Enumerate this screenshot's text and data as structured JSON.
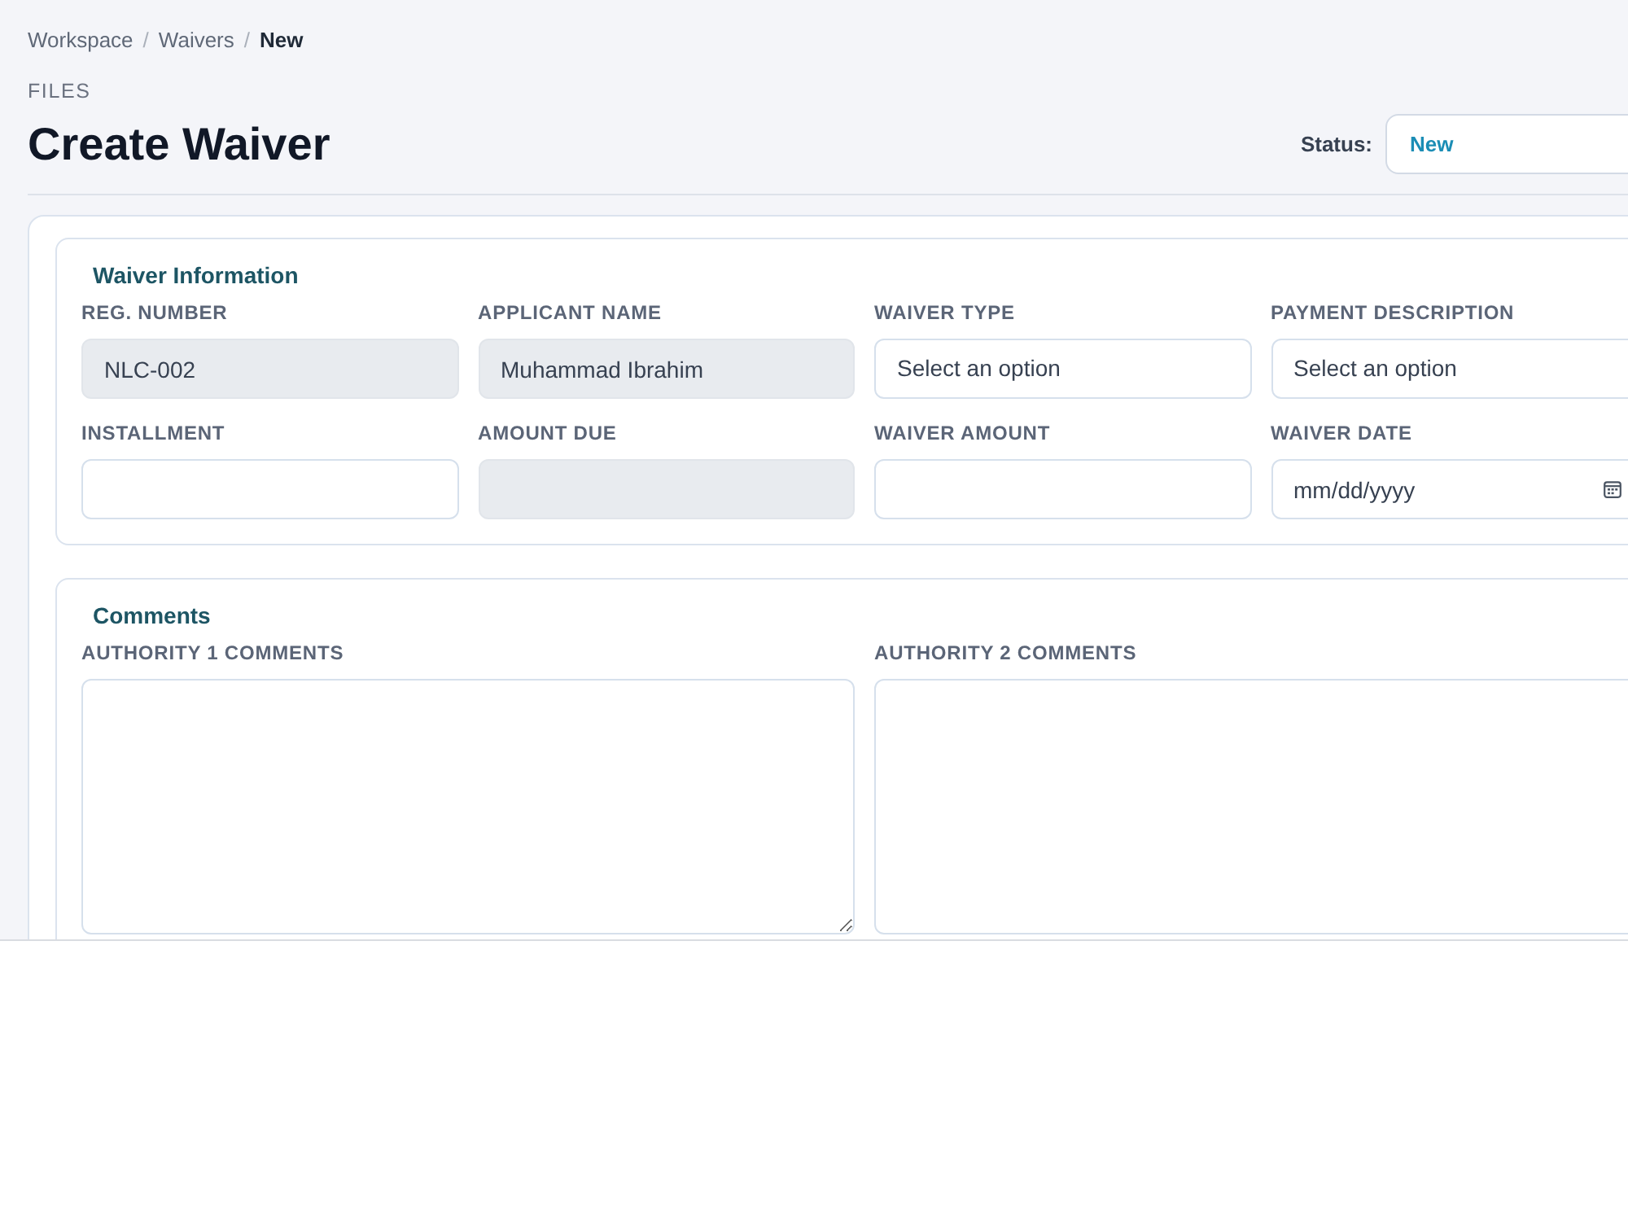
{
  "breadcrumb": [
    {
      "label": "Workspace",
      "current": false
    },
    {
      "separator": "/",
      "label": "Waivers",
      "current": false
    },
    {
      "separator": "/",
      "label": "New",
      "current": true
    }
  ],
  "header": {
    "eyebrow": "FILES",
    "title": "Create Waiver",
    "status": {
      "label": "Status:",
      "value": "New"
    }
  },
  "sections": [
    {
      "title": "Waiver Information",
      "fields": [
        {
          "label": "REG. NUMBER",
          "kind": "text",
          "value": "NLC-002",
          "readonly": true
        },
        {
          "label": "APPLICANT NAME",
          "kind": "text",
          "value": "Muhammad Ibrahim",
          "readonly": true
        },
        {
          "label": "WAIVER TYPE",
          "kind": "select",
          "value": "Select an option",
          "readonly": false
        },
        {
          "label": "PAYMENT DESCRIPTION",
          "kind": "select",
          "value": "Select an option",
          "readonly": false
        },
        {
          "label": "INSTALLMENT",
          "kind": "text",
          "readonly": false
        },
        {
          "label": "AMOUNT DUE",
          "kind": "text",
          "readonly": true
        },
        {
          "label": "WAIVER AMOUNT",
          "kind": "text",
          "readonly": false
        },
        {
          "label": "WAIVER DATE",
          "kind": "date",
          "placeholder": "mm/dd/yyyy",
          "readonly": false
        }
      ]
    },
    {
      "title": "Comments",
      "fields": [
        {
          "label": "AUTHORITY 1 COMMENTS",
          "kind": "textarea",
          "readonly": false
        },
        {
          "label": "AUTHORITY 2 COMMENTS",
          "kind": "textarea",
          "readonly": false
        }
      ]
    }
  ]
}
